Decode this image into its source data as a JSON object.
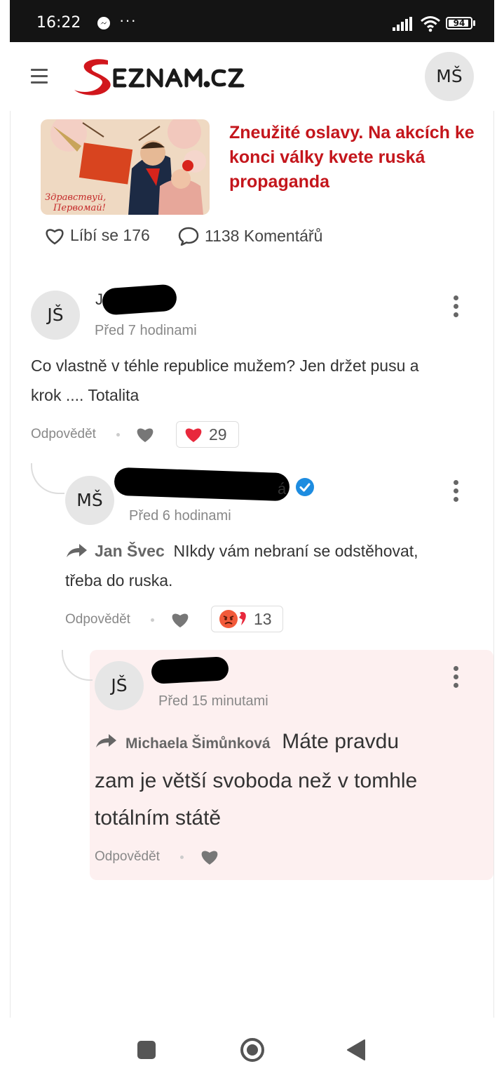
{
  "status_bar": {
    "time": "16:22",
    "dots": "···",
    "battery": "94",
    "battery_level": 0.94
  },
  "header": {
    "user_initials": "MŠ"
  },
  "article": {
    "title": "Zneužité oslavy. Na akcích ke konci války kvete ruská propaganda",
    "poster_caption_line1": "Здравствуй,",
    "poster_caption_line2": "Первомай!",
    "likes_label": "Líbí se 176",
    "comments_label": "1138 Komentářů"
  },
  "comments": [
    {
      "initials": "JŠ",
      "name_prefix": "J",
      "time": "Před 7 hodinami",
      "text_line1": "Co vlastně v téhle republice mužem? Jen držet pusu a",
      "text_line2": "krok .... Totalita",
      "reply_label": "Odpovědět",
      "reaction_count": "29"
    },
    {
      "initials": "MŠ",
      "name_suffix": "á",
      "time": "Před 6 hodinami",
      "mention": "Jan Švec",
      "text_line1": "NIkdy vám nebraní se odstěhovat,",
      "text_line2": "třeba do ruska.",
      "reply_label": "Odpovědět",
      "reaction_count": "13"
    },
    {
      "initials": "JŠ",
      "time": "Před 15 minutami",
      "mention": "Michaela Šimůnková",
      "text_line1": "Máte pravdu",
      "text_line2": "zam je větší svoboda než v tomhle",
      "text_line3": "totálním státě",
      "reply_label": "Odpovědět"
    }
  ],
  "colors": {
    "brand_red": "#c4161c",
    "verified_blue": "#1d8ce0",
    "highlight_bg": "#fdf0f0",
    "status_bar": "#141414"
  },
  "icons": [
    "menu-icon",
    "heart-outline-icon",
    "comment-icon",
    "heart-icon",
    "red-heart-icon",
    "angry-face-icon",
    "reply-arrow-icon",
    "kebab-menu-icon",
    "verified-icon",
    "nav-recents-icon",
    "nav-home-icon",
    "nav-back-icon"
  ]
}
